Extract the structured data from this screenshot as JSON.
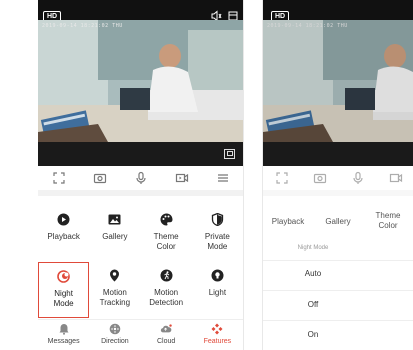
{
  "left": {
    "hd_label": "HD",
    "timestamp": "2019-09-14 18:21:02 THU",
    "features": [
      {
        "label": "Playback",
        "icon": "play-circle-icon"
      },
      {
        "label": "Gallery",
        "icon": "image-icon"
      },
      {
        "label": "Theme Color",
        "icon": "palette-icon"
      },
      {
        "label": "Private Mode",
        "icon": "shield-icon"
      },
      {
        "label": "Night Mode",
        "icon": "night-mode-icon",
        "selected": true
      },
      {
        "label": "Motion Tracking",
        "icon": "location-pin-icon"
      },
      {
        "label": "Motion Detection",
        "icon": "running-icon"
      },
      {
        "label": "Light",
        "icon": "bulb-icon"
      }
    ],
    "nav": [
      {
        "label": "Messages",
        "icon": "bell-icon"
      },
      {
        "label": "Direction",
        "icon": "joystick-icon"
      },
      {
        "label": "Cloud",
        "icon": "cloud-icon"
      },
      {
        "label": "Features",
        "icon": "features-icon",
        "active": true
      }
    ]
  },
  "right": {
    "hd_label": "HD",
    "timestamp": "2019-09-14 18:21:02 THU",
    "features": [
      {
        "label": "Playback"
      },
      {
        "label": "Gallery"
      },
      {
        "label": "Theme Color"
      }
    ],
    "sheet_title": "Night Mode",
    "options": [
      "Auto",
      "Off",
      "On"
    ]
  },
  "colors": {
    "accent": "#e04a3a",
    "icon_dark": "#222222",
    "icon_muted": "#777777"
  }
}
